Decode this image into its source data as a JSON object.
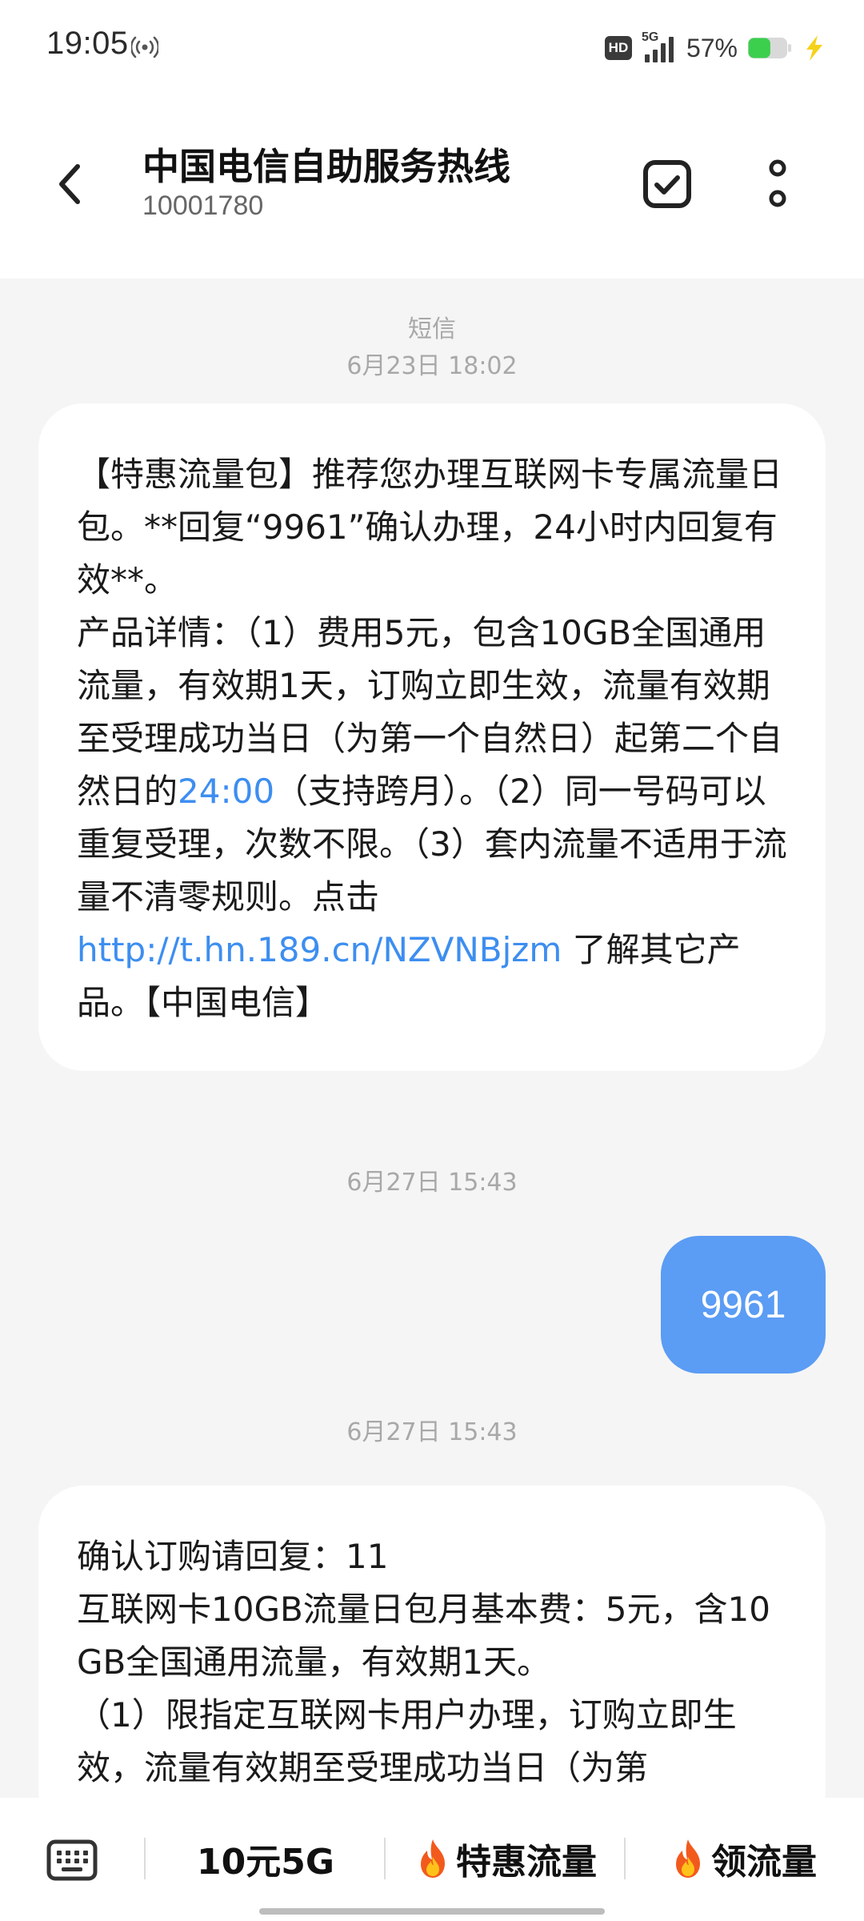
{
  "status_bar": {
    "time": "19:05",
    "hd_label": "HD",
    "network_label": "5G",
    "battery_percent": "57%",
    "battery_level": 0.57,
    "icons": [
      "hotspot-icon",
      "signal-icon",
      "battery-icon",
      "charging-bolt-icon"
    ],
    "battery_color": "#3ccf4e"
  },
  "header": {
    "title": "中国电信自助服务热线",
    "number": "10001780",
    "back_icon": "chevron-left-icon",
    "select_icon": "checkbox-icon",
    "more_icon": "more-vertical-icon"
  },
  "conversation": {
    "channel_label": "短信",
    "messages": [
      {
        "direction": "incoming",
        "timestamp": "6月23日 18:02",
        "text_part1": "【特惠流量包】推荐您办理互联网卡专属流量日包。**回复“9961”确认办理，24小时内回复有效**。\n产品详情：（1）费用5元，包含10GB全国通用流量，有效期1天，订购立即生效，流量有效期至受理成功当日（为第一个自然日）起第二个自然日的",
        "time_link": "24:00",
        "text_part2": "（支持跨月）。（2）同一号码可以重复受理，次数不限。（3）套内流量不适用于流量不清零规则。点击\n",
        "url_link": "http://t.hn.189.cn/NZVNBjzm",
        "text_part3": " 了解其它产品。【中国电信】"
      },
      {
        "direction": "outgoing",
        "timestamp": "6月27日 15:43",
        "text": "9961"
      },
      {
        "direction": "incoming",
        "timestamp": "6月27日 15:43",
        "text": "确认订购请回复：11\n互联网卡10GB流量日包月基本费：5元，含10GB全国通用流量，有效期1天。\n（1）限指定互联网卡用户办理，订购立即生效，流量有效期至受理成功当日（为第"
      }
    ]
  },
  "bottom_menu": {
    "keyboard_icon": "keyboard-icon",
    "items": [
      {
        "label": "10元5G",
        "icon": ""
      },
      {
        "label": "特惠流量",
        "icon": "fire-icon"
      },
      {
        "label": "领流量",
        "icon": "fire-icon"
      }
    ]
  },
  "colors": {
    "accent": "#5b9cf4",
    "link": "#3d8ef0",
    "background": "#f5f5f5"
  }
}
